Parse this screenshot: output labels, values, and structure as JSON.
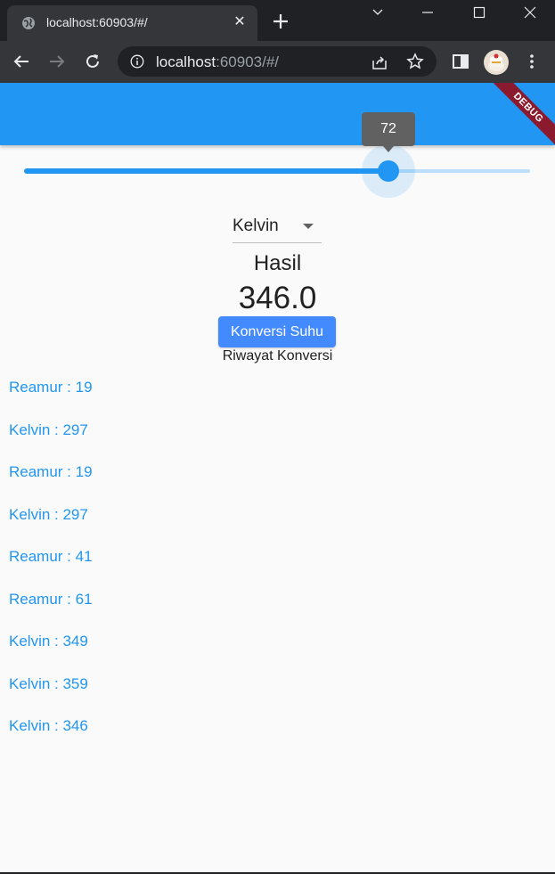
{
  "browser": {
    "tab_title": "localhost:60903/#/",
    "url_host": "localhost",
    "url_rest": ":60903/#/"
  },
  "app": {
    "debug_label": "DEBUG",
    "slider": {
      "value": 72,
      "fraction": 0.72
    },
    "dropdown": {
      "selected": "Kelvin"
    },
    "result_label": "Hasil",
    "result_value": "346.0",
    "convert_button": "Konversi Suhu",
    "history_title": "Riwayat Konversi",
    "history": [
      "Reamur : 19",
      "Kelvin : 297",
      "Reamur : 19",
      "Kelvin : 297",
      "Reamur : 41",
      "Reamur : 61",
      "Kelvin : 349",
      "Kelvin : 359",
      "Kelvin : 346"
    ]
  },
  "colors": {
    "primary": "#2196f3",
    "button": "#448aff",
    "debug": "#8b1a2f"
  }
}
